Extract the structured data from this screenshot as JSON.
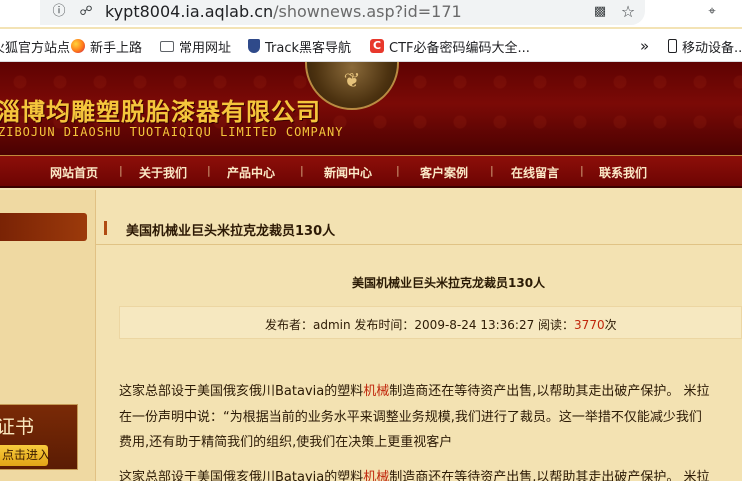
{
  "browser": {
    "url_host": "kypt8004.ia.aqlab.cn",
    "url_path": "/shownews.asp?id=171",
    "bookmarks": [
      {
        "label": "火狐官方站点",
        "icon": "site-icon",
        "color": "#7a3fbf"
      },
      {
        "label": "新手上路",
        "icon": "firefox-icon",
        "color": "#ff7a18"
      },
      {
        "label": "常用网址",
        "icon": "folder-icon",
        "color": "#5f6368"
      },
      {
        "label": "Track黑客导航",
        "icon": "shield-icon",
        "color": "#2f4a8a"
      },
      {
        "label": "CTF必备密码编码大全...",
        "icon": "ctf-icon",
        "color": "#e8382c"
      },
      {
        "label": "移动设备...",
        "icon": "mobile-icon",
        "color": "#202124"
      }
    ]
  },
  "site": {
    "company_cn": "淄博均雕塑脱胎漆器有限公司",
    "company_en": "ZIBOJUN DIAOSHU  TUOTAIQIQU  LIMITED COMPANY",
    "emblem_text": "❦"
  },
  "nav": [
    "网站首页",
    "关于我们",
    "产品中心",
    "新闻中心",
    "客户案例",
    "在线留言",
    "联系我们"
  ],
  "nav_separator": "|",
  "sidebar": {
    "box_title": "证书",
    "box_button": "点击进入"
  },
  "article": {
    "section_title": "美国机械业巨头米拉克龙裁员130人",
    "title": "美国机械业巨头米拉克龙裁员130人",
    "meta_prefix": "发布者：admin 发布时间：2009-8-24 13:36:27 阅读：",
    "views": "3770",
    "views_suffix": "次",
    "para1_line1_a": "这家总部设于美国俄亥俄川Batavia的塑料",
    "para1_line1_hl": "机械",
    "para1_line1_b": "制造商还在等待资产出售,以帮助其走出破产保护。 米拉",
    "para1_line2": "在一份声明中说：“为根据当前的业务水平来调整业务规模,我们进行了裁员。这一举措不仅能减少我们",
    "para1_line3": "费用,还有助于精简我们的组织,使我们在决策上更重视客户",
    "para2_line1_a": "这家总部设于美国俄亥俄川Batavia的塑料",
    "para2_line1_hl": "机械",
    "para2_line1_b": "制造商还在等待资产出售,以帮助其走出破产保护。 米拉"
  }
}
